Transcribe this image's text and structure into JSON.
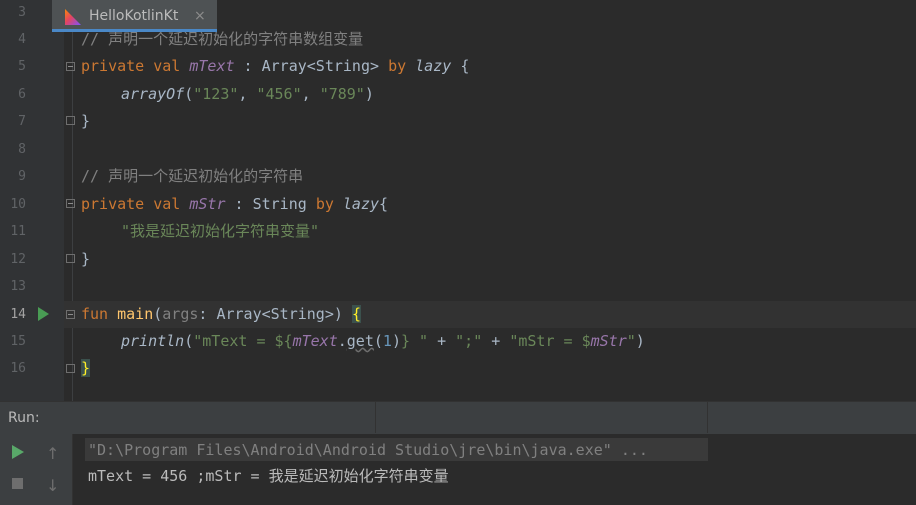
{
  "editor": {
    "line_numbers": [
      "3",
      "4",
      "5",
      "6",
      "7",
      "8",
      "9",
      "10",
      "11",
      "12",
      "13",
      "14",
      "15",
      "16"
    ],
    "comment1": "// 声明一个延迟初始化的字符串数组变量",
    "comment2": "// 声明一个延迟初始化的字符串",
    "kw_private": "private",
    "kw_val": "val",
    "kw_by": "by",
    "kw_fun": "fun",
    "prop_mtext": "mText",
    "prop_mstr": "mStr",
    "type_array_string": "Array<String>",
    "type_string": "String",
    "fn_lazy": "lazy",
    "fn_arrayof": "arrayOf",
    "fn_main": "main",
    "fn_println": "println",
    "fn_get": "get",
    "param_args": "args",
    "str_123": "\"123\"",
    "str_456": "\"456\"",
    "str_789": "\"789\"",
    "str_chinese": "\"我是延迟初始化字符串变量\"",
    "str_mtext_prefix": "\"mText = ${",
    "str_interp_close": "}",
    "str_semicolon": "\";\"",
    "str_mstr_prefix": "\"mStr = $",
    "num_1": "1",
    "colon": " : ",
    "open_brace": "{",
    "close_brace": "}",
    "comma": ", ",
    "plus": " + ",
    "quote": "\""
  },
  "run_panel": {
    "label": "Run:",
    "tab_title": "HelloKotlinKt",
    "tab_close": "×",
    "command_line": "\"D:\\Program Files\\Android\\Android Studio\\jre\\bin\\java.exe\" ...",
    "output_line": "mText = 456 ;mStr = 我是延迟初始化字符串变量",
    "up_arrow": "↑",
    "down_arrow": "↓"
  },
  "colors": {
    "background": "#2b2b2b",
    "keyword": "#cc7832",
    "string": "#6a8759",
    "property": "#9876aa",
    "function": "#ffc66d",
    "run_green": "#59a869",
    "tab_underline": "#4a88c7"
  }
}
